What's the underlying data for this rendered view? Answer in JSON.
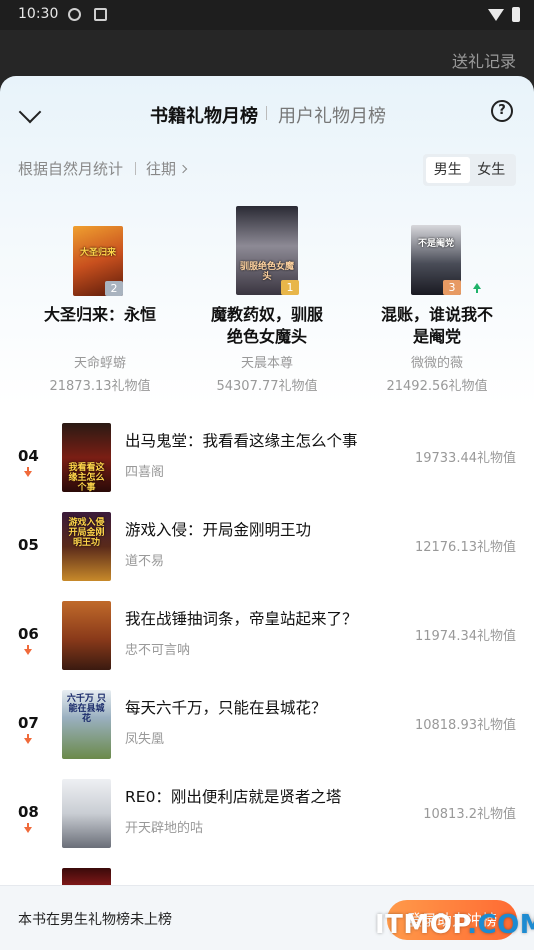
{
  "status_bar": {
    "time": "10:30"
  },
  "background": {
    "gift_record": "送礼记录"
  },
  "header": {
    "tab_book": "书籍礼物月榜",
    "tab_user": "用户礼物月榜",
    "help_symbol": "?"
  },
  "subheader": {
    "stat_label": "根据自然月统计",
    "past_label": "往期",
    "gender_male": "男生",
    "gender_female": "女生",
    "selected_gender": "男生"
  },
  "podium": [
    {
      "rank": "2",
      "title_line1": "大圣归来：永恒",
      "title_line2": "",
      "author": "天命蜉蝣",
      "value": "21873.13礼物值",
      "cover_text": "大圣归来",
      "cover_color": "#c8501e",
      "tag_color": "#a9b3bf"
    },
    {
      "rank": "1",
      "title_line1": "魔教药奴，驯服",
      "title_line2": "绝色女魔头",
      "author": "天晨本尊",
      "value": "54307.77礼物值",
      "cover_text": "驯服绝色女魔头",
      "cover_color": "#6d6a75",
      "tag_color": "#e8b64a"
    },
    {
      "rank": "3",
      "title_line1": "混账，谁说我不",
      "title_line2": "是阉党",
      "author": "微微的薇",
      "value": "21492.56礼物值",
      "cover_text": "不是阉党",
      "cover_color": "#4a4d58",
      "tag_color": "#e79a63",
      "trend": "up"
    }
  ],
  "list": [
    {
      "rank": "04",
      "title": "出马鬼堂：我看看这缘主怎么个事",
      "author": "四喜阁",
      "value": "19733.44礼物值",
      "trend": "down",
      "cover_text": "我看看这缘主怎么个事",
      "cover_color": "#7a1e14"
    },
    {
      "rank": "05",
      "title": "游戏入侵：开局金刚明王功",
      "author": "道不易",
      "value": "12176.13礼物值",
      "trend": "none",
      "cover_text": "游戏入侵 开局金刚明王功",
      "cover_color": "#5a2a1a"
    },
    {
      "rank": "06",
      "title": "我在战锤抽词条，帝皇站起来了？",
      "author": "忠不可言呐",
      "value": "11974.34礼物值",
      "trend": "down",
      "cover_text": "",
      "cover_color": "#8a3a1a"
    },
    {
      "rank": "07",
      "title": "每天六千万，只能在县城花？",
      "author": "凤失凰",
      "value": "10818.93礼物值",
      "trend": "down",
      "cover_text": "六千万 只能在县城花",
      "cover_color": "#6b8a4a"
    },
    {
      "rank": "08",
      "title": "RE0：刚出便利店就是贤者之塔",
      "author": "开天辟地的咕",
      "value": "10813.2礼物值",
      "trend": "down",
      "cover_text": "",
      "cover_color": "#c9cdd3"
    }
  ],
  "footer": {
    "note": "本书在男生礼物榜未上榜",
    "boost_button": "登录助力冲榜"
  },
  "watermark": {
    "part1": "ITMOP",
    "part2": ".COM"
  }
}
